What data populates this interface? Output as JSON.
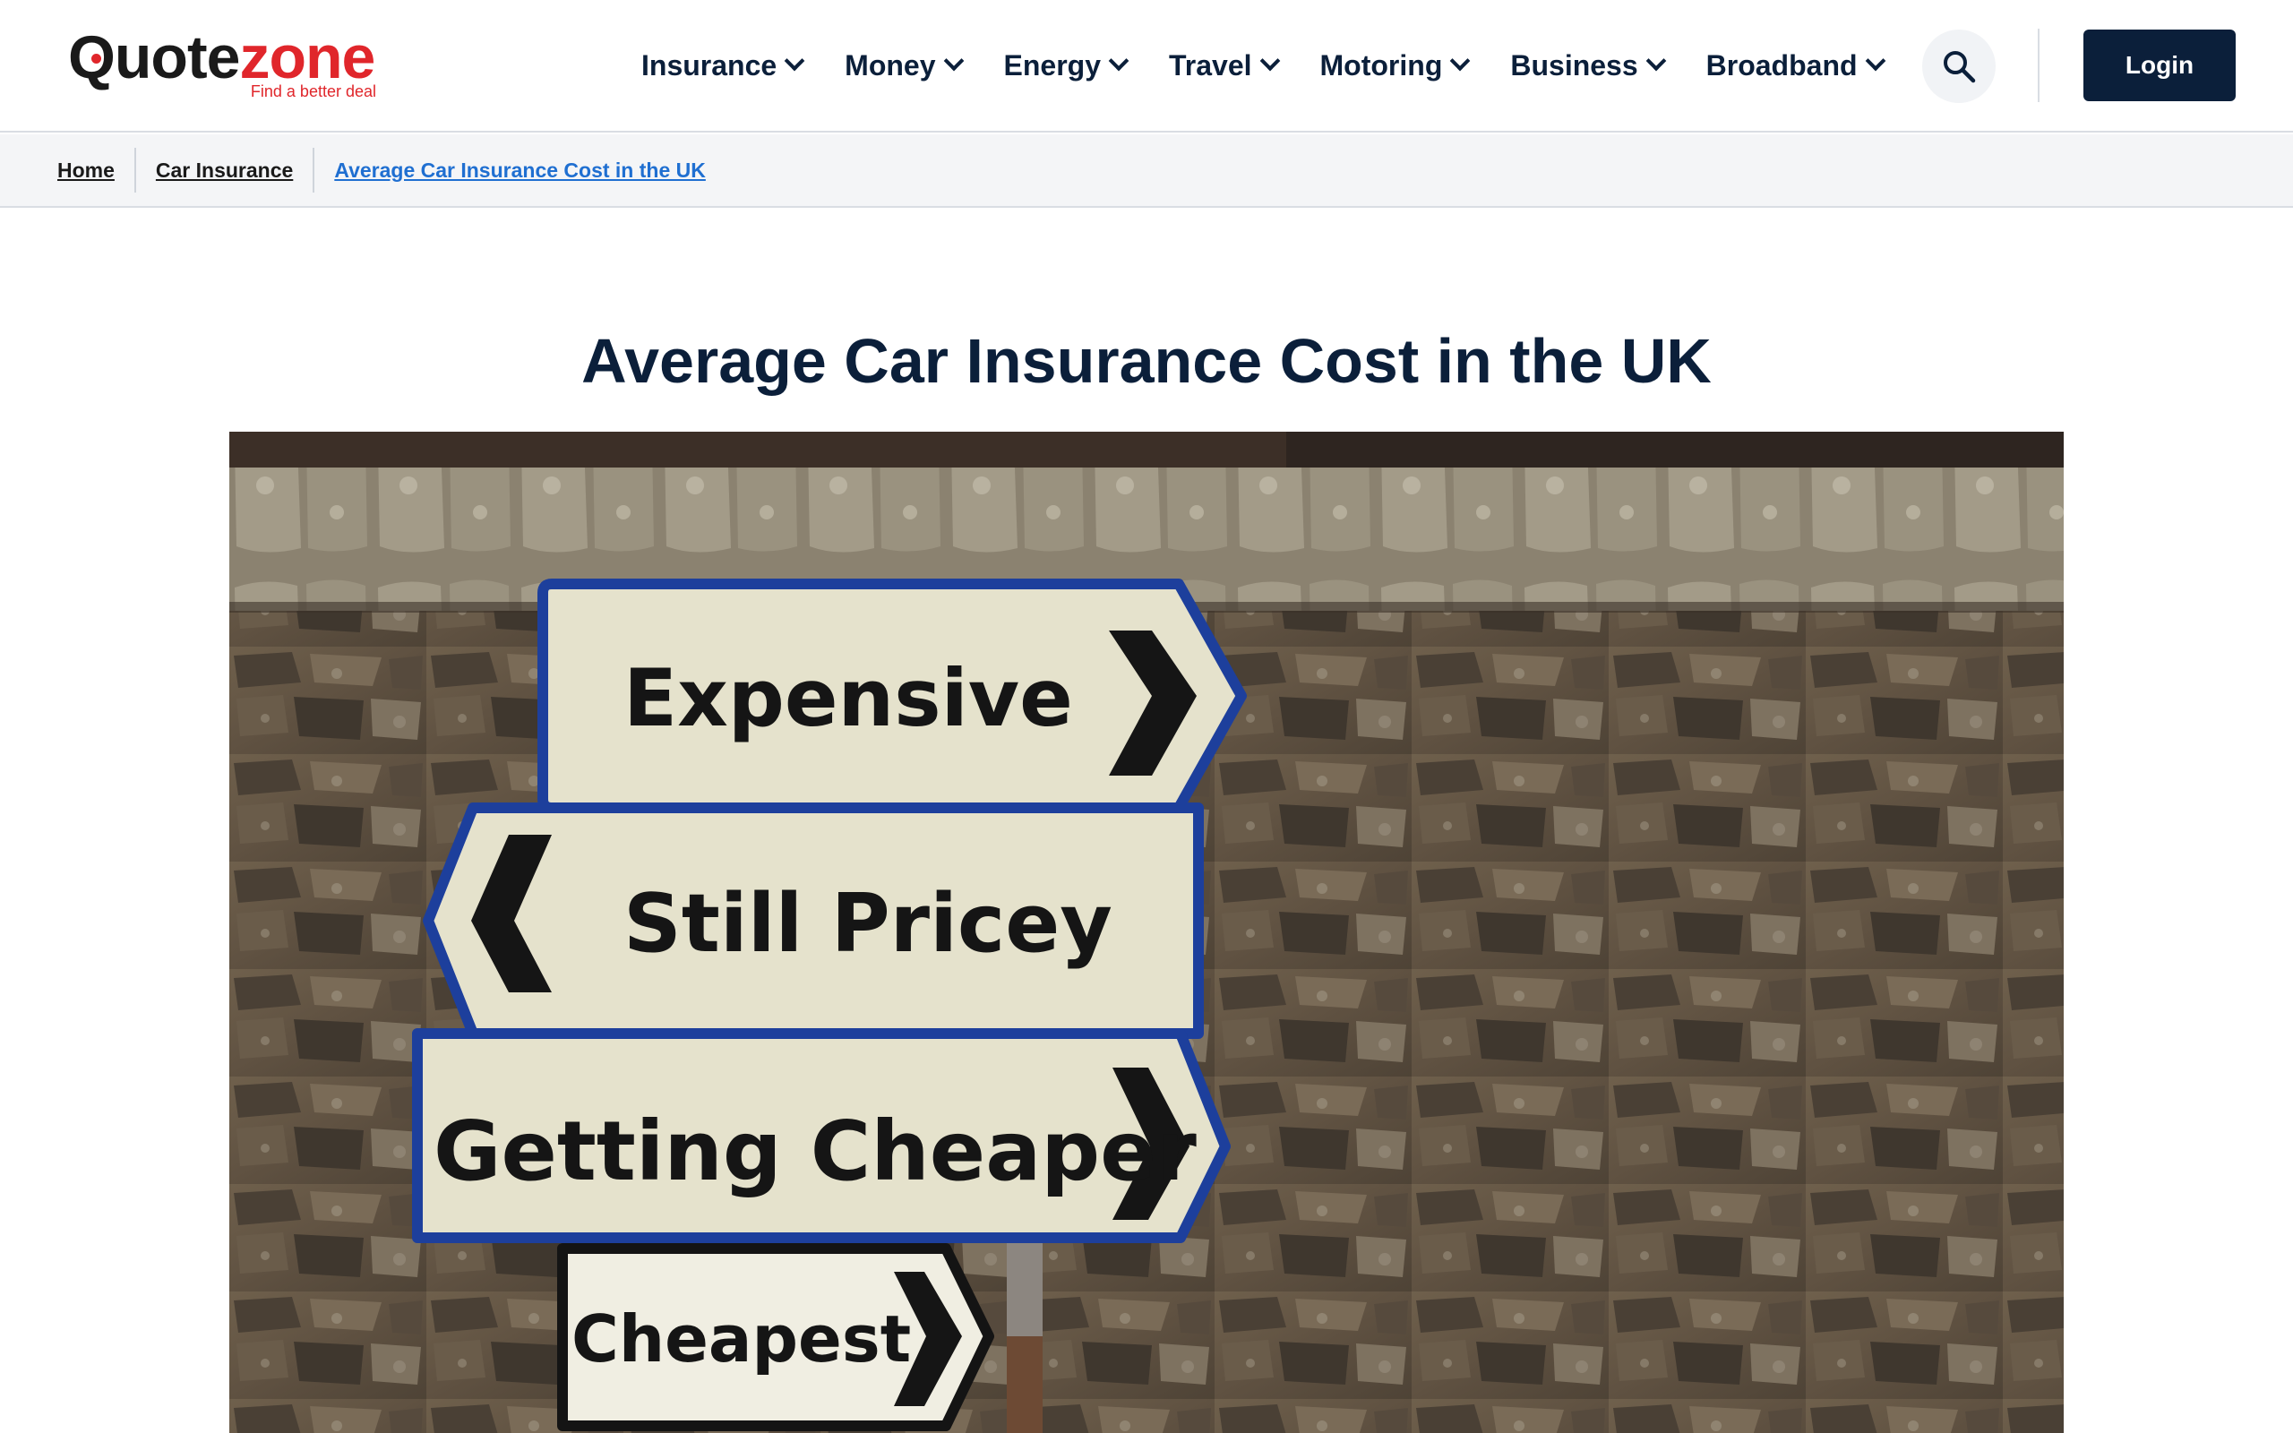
{
  "brand": {
    "name_part1": "Quote",
    "name_part2": "zone",
    "tagline": "Find a better deal",
    "primary_color": "#0b1f3a",
    "accent_color": "#e0262b"
  },
  "nav": {
    "items": [
      {
        "label": "Insurance"
      },
      {
        "label": "Money"
      },
      {
        "label": "Energy"
      },
      {
        "label": "Travel"
      },
      {
        "label": "Motoring"
      },
      {
        "label": "Business"
      },
      {
        "label": "Broadband"
      }
    ],
    "search_icon": "search-icon",
    "login_label": "Login"
  },
  "breadcrumb": {
    "items": [
      {
        "label": "Home"
      },
      {
        "label": "Car Insurance"
      },
      {
        "label": "Average Car Insurance Cost in the UK"
      }
    ]
  },
  "main": {
    "title": "Average Car Insurance Cost in the UK",
    "hero": {
      "signs": [
        {
          "text": "Expensive",
          "direction": "right"
        },
        {
          "text": "Still Pricey",
          "direction": "left"
        },
        {
          "text": "Getting Cheaper",
          "direction": "right"
        },
        {
          "text": "Cheapest",
          "direction": "right"
        }
      ]
    }
  }
}
